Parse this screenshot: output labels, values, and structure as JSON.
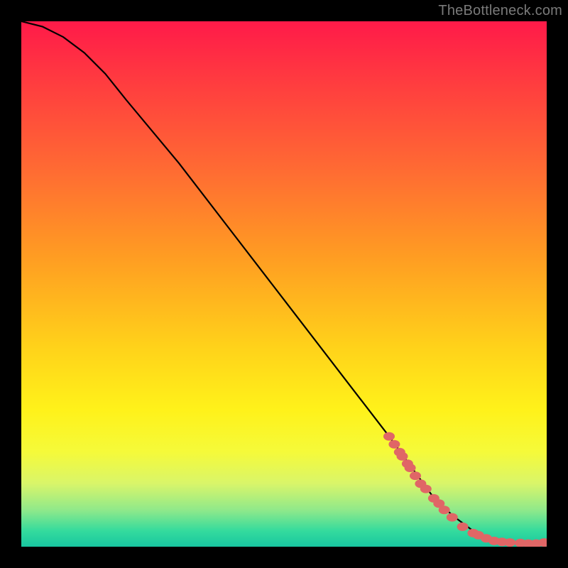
{
  "watermark": "TheBottleneck.com",
  "chart_data": {
    "type": "line",
    "title": "",
    "xlabel": "",
    "ylabel": "",
    "xlim": [
      0,
      100
    ],
    "ylim": [
      0,
      100
    ],
    "grid": false,
    "legend": false,
    "series": [
      {
        "name": "curve",
        "style": "line",
        "color": "#000000",
        "x": [
          0,
          4,
          8,
          12,
          16,
          20,
          30,
          40,
          50,
          60,
          70,
          78,
          82,
          86,
          90,
          94,
          98,
          100
        ],
        "y": [
          100,
          99,
          97,
          94,
          90,
          85,
          73,
          60,
          47,
          34,
          21,
          10,
          6,
          3,
          1,
          0.6,
          0.4,
          0.5
        ]
      },
      {
        "name": "marker-cluster",
        "style": "scatter",
        "color": "#e06666",
        "x": [
          70,
          71,
          72,
          72.5,
          73.5,
          74,
          75,
          76,
          77,
          78.5,
          79.5,
          80.5,
          82,
          84,
          86,
          87,
          88.5,
          90,
          91.5,
          93,
          95,
          96.5,
          98,
          99.5
        ],
        "y": [
          21,
          19.5,
          18,
          17.2,
          15.8,
          15,
          13.5,
          12,
          11,
          9.2,
          8.2,
          7,
          5.6,
          3.8,
          2.6,
          2.2,
          1.6,
          1.1,
          0.9,
          0.8,
          0.7,
          0.6,
          0.6,
          0.8
        ]
      }
    ]
  }
}
